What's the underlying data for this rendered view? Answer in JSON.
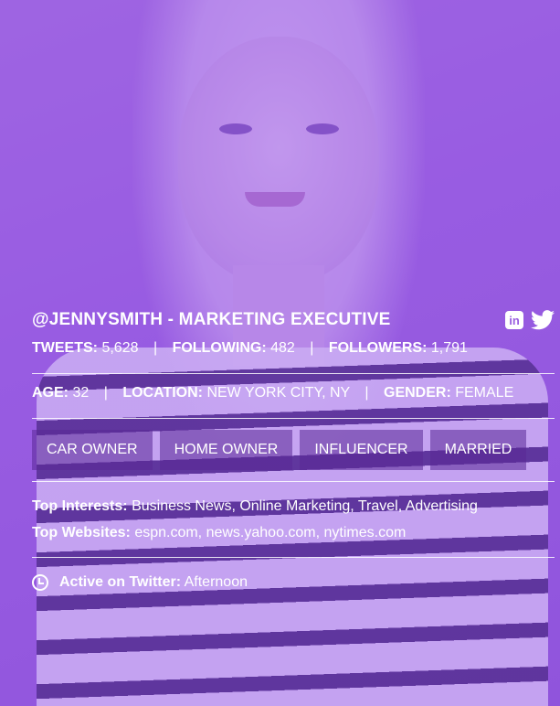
{
  "profile": {
    "handle": "@JENNYSMITH - MARKETING EXECUTIVE",
    "stats": {
      "tweets_label": "TWEETS:",
      "tweets": "5,628",
      "following_label": "FOLLOWING:",
      "following": "482",
      "followers_label": "FOLLOWERS:",
      "followers": "1,791",
      "separator": "|"
    },
    "demo": {
      "age_label": "AGE:",
      "age": "32",
      "location_label": "LOCATION:",
      "location": "NEW YORK CITY, NY",
      "gender_label": "GENDER:",
      "gender": "FEMALE"
    },
    "tags": [
      "CAR OWNER",
      "HOME OWNER",
      "INFLUENCER",
      "MARRIED"
    ],
    "interests_label": "Top Interests:",
    "interests": "Business News, Online Marketing, Travel, Advertising",
    "websites_label": "Top Websites:",
    "websites": "espn.com, news.yahoo.com, nytimes.com",
    "active_label": "Active on Twitter:",
    "active": "Afternoon",
    "social_icons": [
      "linkedin-icon",
      "twitter-icon"
    ],
    "linkedin_glyph": "in"
  },
  "colors": {
    "overlay": "#9a5ee0",
    "tag_bg": "#5a2896"
  }
}
